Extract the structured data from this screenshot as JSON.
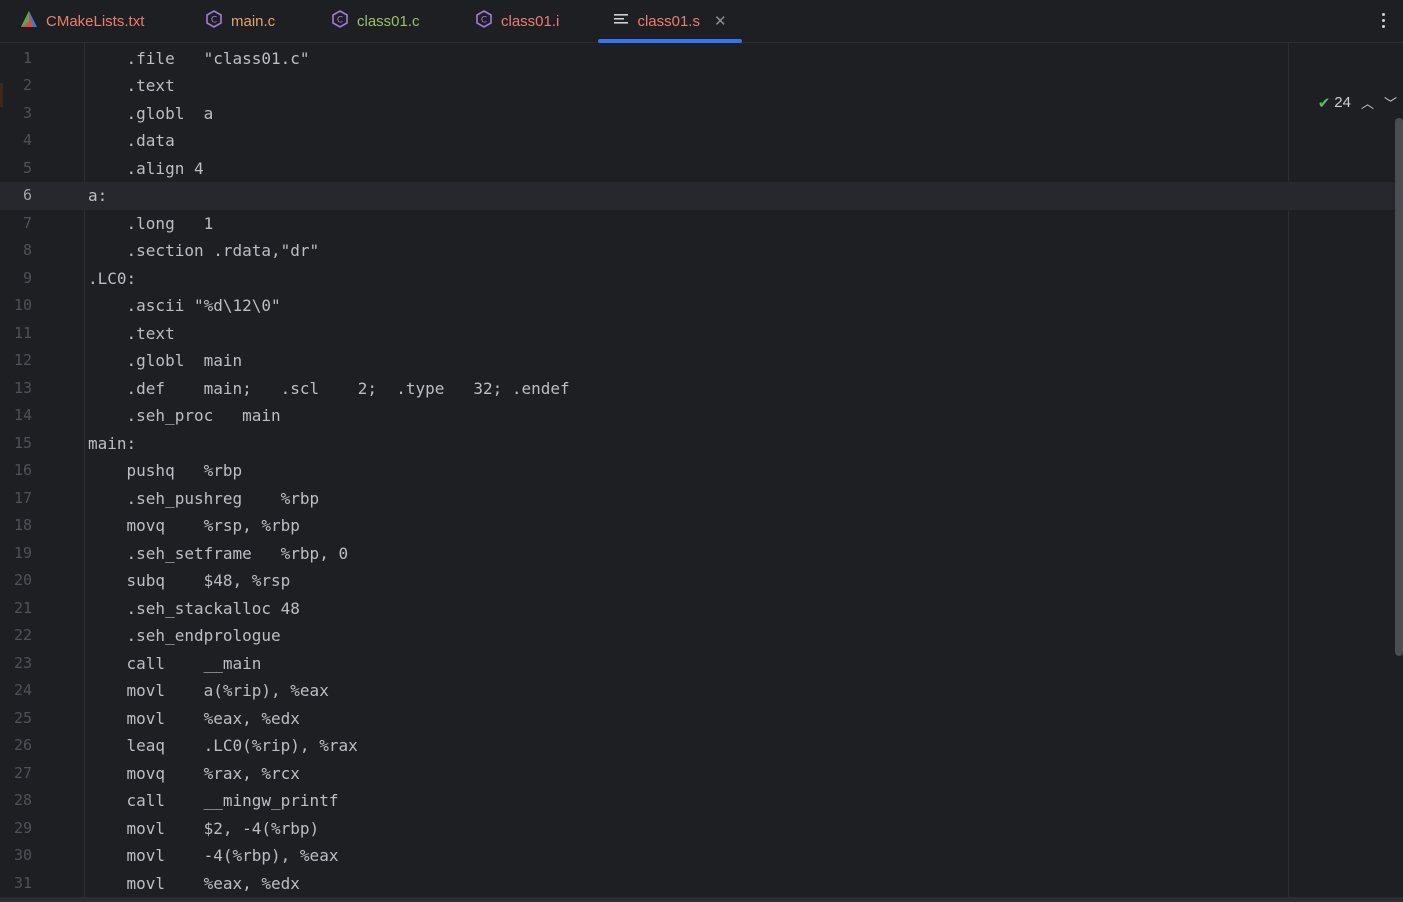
{
  "tabs": [
    {
      "label": "CMakeLists.txt",
      "icon": "cmake-icon",
      "color": "#e87d74"
    },
    {
      "label": "main.c",
      "icon": "c-file-icon",
      "color": "#e0a568"
    },
    {
      "label": "class01.c",
      "icon": "c-file-icon",
      "color": "#99c06a"
    },
    {
      "label": "class01.i",
      "icon": "c-file-icon",
      "color": "#e87d74"
    },
    {
      "label": "class01.s",
      "icon": "text-file-icon",
      "color": "#e87d74",
      "active": true
    }
  ],
  "accent_color": "#3574f0",
  "inspection": {
    "count": "24"
  },
  "current_line": 6,
  "lines": [
    "    .file   \"class01.c\"",
    "    .text",
    "    .globl  a",
    "    .data",
    "    .align 4",
    "a:",
    "    .long   1",
    "    .section .rdata,\"dr\"",
    ".LC0:",
    "    .ascii \"%d\\12\\0\"",
    "    .text",
    "    .globl  main",
    "    .def    main;   .scl    2;  .type   32; .endef",
    "    .seh_proc   main",
    "main:",
    "    pushq   %rbp",
    "    .seh_pushreg    %rbp",
    "    movq    %rsp, %rbp",
    "    .seh_setframe   %rbp, 0",
    "    subq    $48, %rsp",
    "    .seh_stackalloc 48",
    "    .seh_endprologue",
    "    call    __main",
    "    movl    a(%rip), %eax",
    "    movl    %eax, %edx",
    "    leaq    .LC0(%rip), %rax",
    "    movq    %rax, %rcx",
    "    call    __mingw_printf",
    "    movl    $2, -4(%rbp)",
    "    movl    -4(%rbp), %eax",
    "    movl    %eax, %edx"
  ]
}
